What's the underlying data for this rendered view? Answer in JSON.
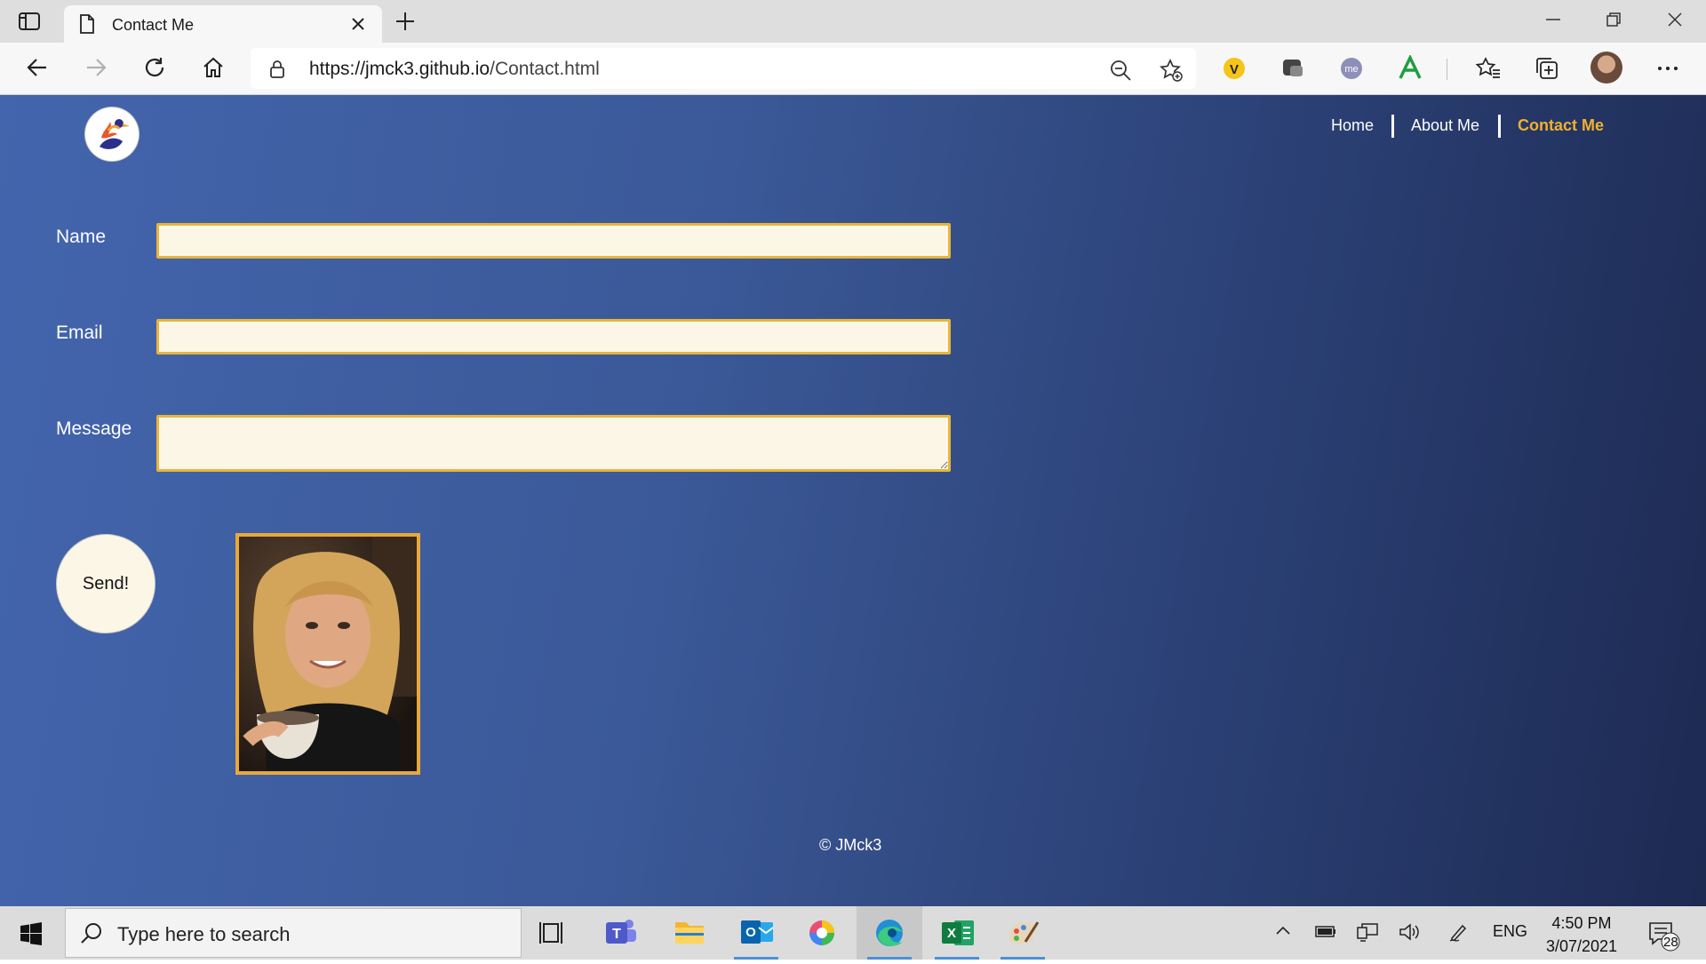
{
  "browser": {
    "tab_title": "Contact Me",
    "url_host": "https://jmck3.github.io",
    "url_path": "/Contact.html"
  },
  "site": {
    "nav": {
      "home": "Home",
      "about": "About Me",
      "contact": "Contact Me"
    },
    "form": {
      "name_label": "Name",
      "email_label": "Email",
      "message_label": "Message",
      "name_value": "",
      "email_value": "",
      "message_value": "",
      "send_label": "Send!"
    },
    "footer": "© JMck3",
    "colors": {
      "accent": "#f2b02e",
      "input_bg": "#fcf6e6",
      "page_start": "#4365ad",
      "page_end": "#1d2a52"
    }
  },
  "taskbar": {
    "search_placeholder": "Type here to search",
    "language": "ENG",
    "time": "4:50 PM",
    "date": "3/07/2021",
    "notification_count": "28"
  }
}
